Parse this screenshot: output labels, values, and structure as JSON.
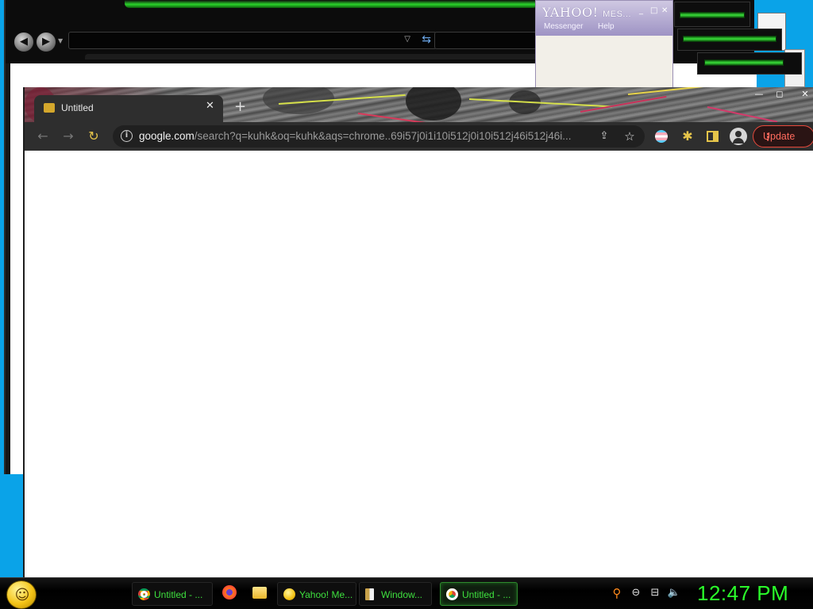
{
  "background_window": {
    "nav_back_icon": "back-arrow-icon",
    "nav_forward_icon": "forward-arrow-icon"
  },
  "yahoo_messenger": {
    "title_logo": "YAHOO!",
    "title_suffix": "MES...",
    "controls": [
      "_",
      "□",
      "✕"
    ],
    "menu": [
      "Messenger",
      "Help"
    ]
  },
  "chrome": {
    "tab_title": "Untitled",
    "tab_close": "✕",
    "new_tab": "+",
    "window_controls": [
      "—",
      "◻",
      "✕"
    ],
    "url_host": "google.com",
    "url_rest": "/search?q=kuhk&oq=kuhk&aqs=chrome..69i57j0i1i10i512j0i10i512j46i512j46i...",
    "update_label": "Update"
  },
  "taskbar": {
    "tasks": [
      {
        "label": "Untitled - ...",
        "icon": "chrome-icon"
      },
      {
        "label": "Yahoo! Me...",
        "icon": "yahoo-smiley-icon"
      },
      {
        "label": "Window...",
        "icon": "window-icon"
      },
      {
        "label": "Untitled - ...",
        "icon": "chrome-icon",
        "active": true
      }
    ],
    "quick_launch": [
      "firefox-icon",
      "folder-icon"
    ],
    "tray": [
      "search-icon",
      "messenger-status-icon",
      "network-icon",
      "volume-icon"
    ],
    "clock": "12:47 PM"
  },
  "colors": {
    "desktop": "#0aa3e8",
    "taskbar_text": "#3ee03e",
    "clock": "#2bff2b",
    "update_accent": "#e8493c"
  }
}
